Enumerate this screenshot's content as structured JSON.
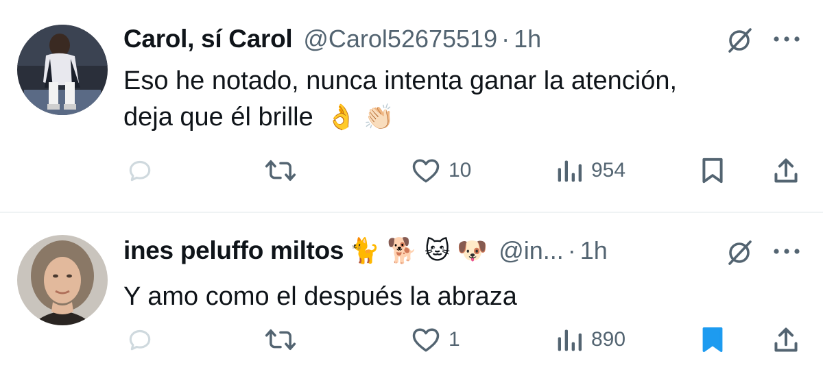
{
  "tweets": [
    {
      "name": "Carol, sí Carol",
      "handle": "@Carol52675519",
      "separator": "·",
      "time": "1h",
      "name_emoji": "",
      "text_line1": "Eso he notado, nunca intenta ganar la atención,",
      "text_line2": "deja que él brille",
      "text_emoji": "👌 👏🏻",
      "likes": "10",
      "views": "954",
      "bookmarked": false
    },
    {
      "name": "ines peluffo miltos",
      "handle": "@in...",
      "separator": "·",
      "time": "1h",
      "name_emoji": "🐈 🐕 🐱 🐶",
      "text_line1": "Y amo como el después la abraza",
      "text_line2": "",
      "text_emoji": "",
      "likes": "1",
      "views": "890",
      "bookmarked": true
    }
  ],
  "icons": {
    "reply": "reply-icon",
    "retweet": "retweet-icon",
    "like": "heart-icon",
    "views": "views-icon",
    "bookmark": "bookmark-icon",
    "share": "share-icon",
    "grok": "grok-icon",
    "more": "more-icon"
  },
  "colors": {
    "text": "#0f1419",
    "muted": "#536471",
    "reply_disabled": "#cfd9de",
    "bookmark_active": "#1d9bf0",
    "divider": "#eff3f4"
  }
}
